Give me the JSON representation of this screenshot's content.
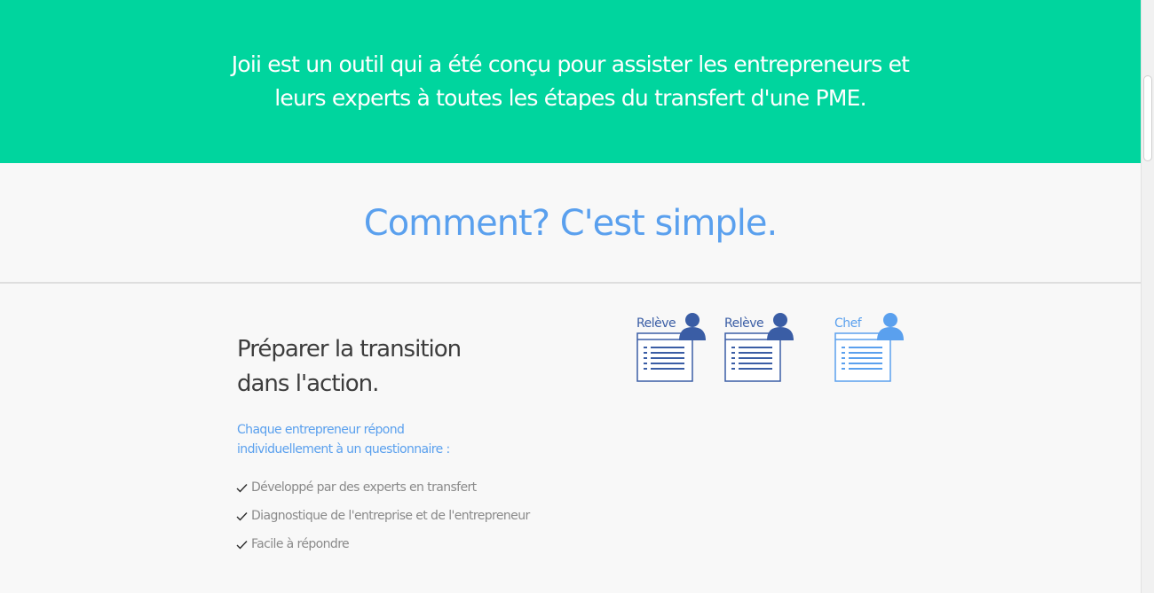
{
  "hero": {
    "lines": [
      "Joii est un outil qui a été conçu pour assister les entrepreneurs et",
      "leurs experts à toutes les étapes du transfert d'une PME."
    ],
    "background": "#00d59e"
  },
  "section": {
    "title": "Comment? C'est simple."
  },
  "feature": {
    "title_lines": [
      "Préparer la transition",
      "dans l'action."
    ],
    "lead_lines": [
      "Chaque entrepreneur répond",
      "individuellement à un questionnaire :"
    ],
    "checklist": [
      {
        "icon": "checkmark-icon",
        "text": "Développé par des experts en transfert"
      },
      {
        "icon": "checkmark-icon",
        "text": "Diagnostique de l'entreprise et de l'entrepreneur"
      },
      {
        "icon": "checkmark-icon",
        "text": "Facile à répondre"
      }
    ]
  },
  "roles": [
    {
      "label": "Relève",
      "icon": "user-questionnaire-icon",
      "color": "#3a5da5"
    },
    {
      "label": "Relève",
      "icon": "user-questionnaire-icon",
      "color": "#3a5da5"
    },
    {
      "label": "Chef",
      "icon": "user-questionnaire-icon",
      "color": "#5aa0ee"
    }
  ],
  "colors": {
    "accent": "#5aa0ee",
    "dark_blue": "#3a5da5",
    "heading": "#3d3d3d",
    "muted": "#8a8a8a"
  }
}
